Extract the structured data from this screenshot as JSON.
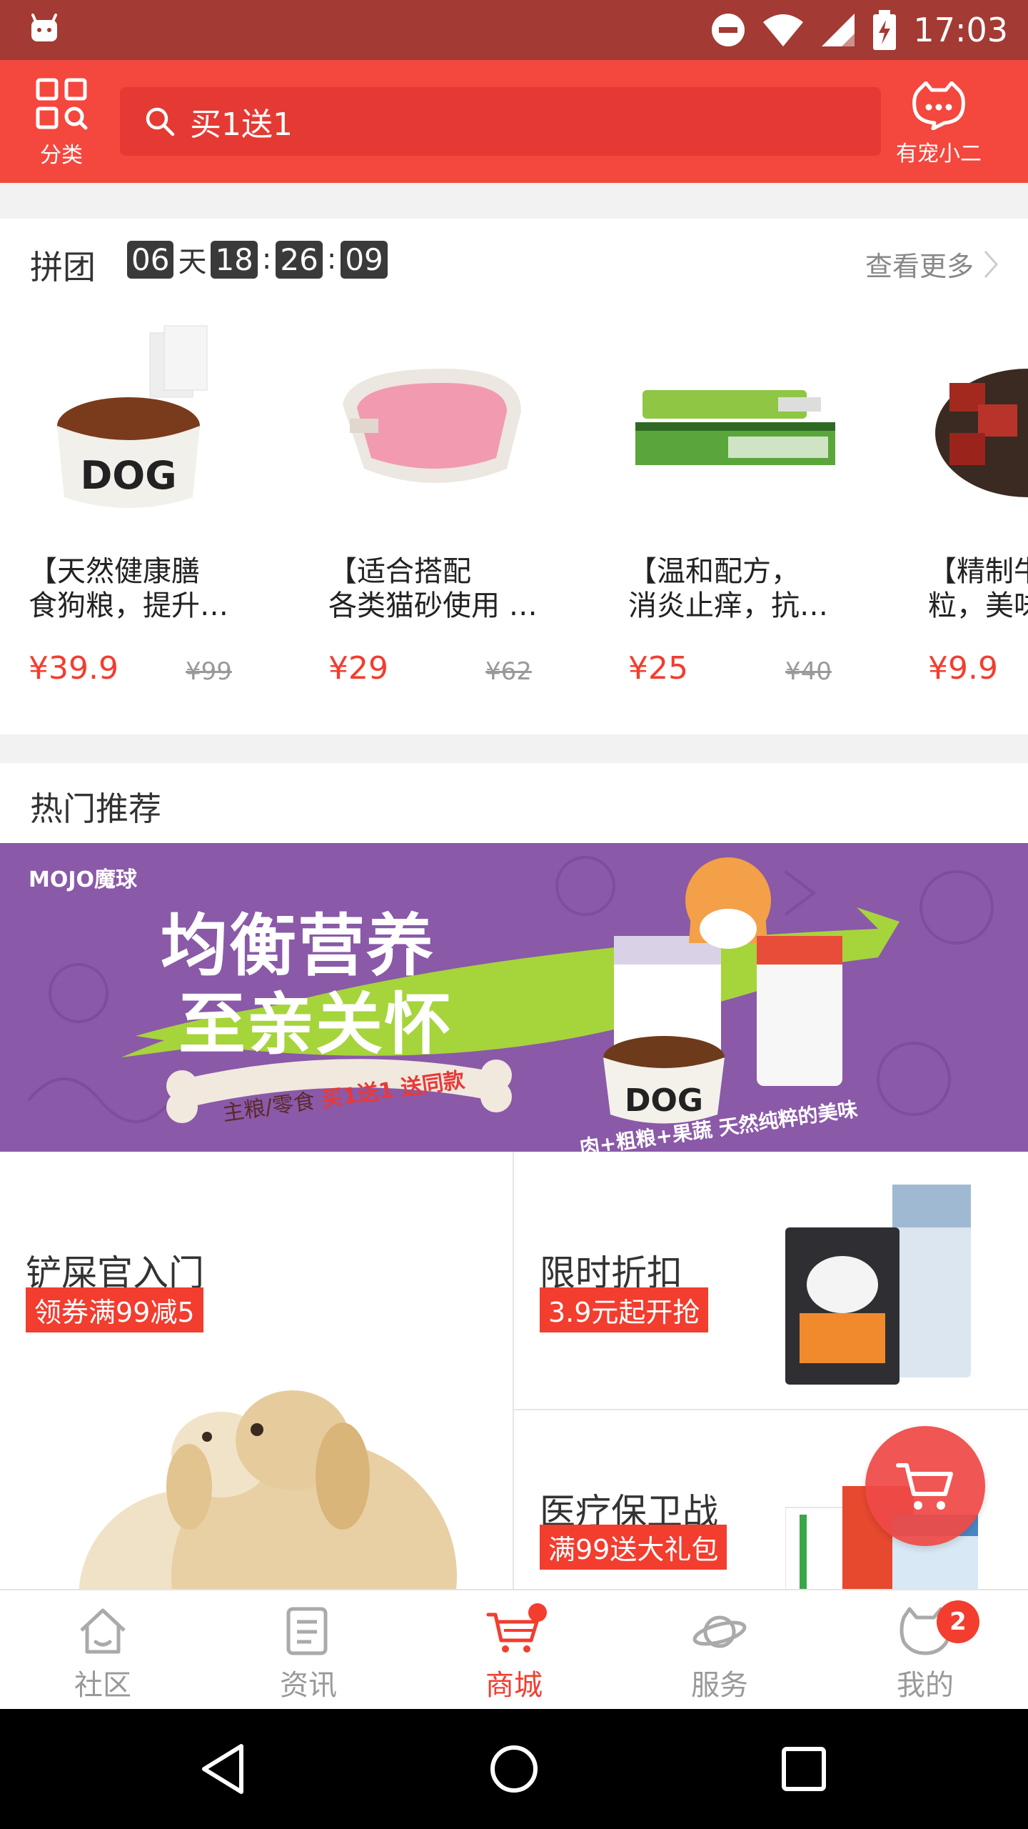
{
  "status_bar": {
    "time": "17:03"
  },
  "header": {
    "category_label": "分类",
    "search_placeholder": "买1送1",
    "helper_label": "有宠小二"
  },
  "group_buy": {
    "title": "拼团",
    "countdown": {
      "days": "06",
      "days_unit": "天",
      "hours": "18",
      "sep1": ":",
      "minutes": "26",
      "sep2": ":",
      "seconds": "09"
    },
    "more_label": "查看更多",
    "products": [
      {
        "name": "【天然健康膳\n食狗粮，提升…",
        "price": "¥39.9",
        "original_price": "¥99"
      },
      {
        "name": "【适合搭配\n各类猫砂使用 …",
        "price": "¥29",
        "original_price": "¥62"
      },
      {
        "name": "【温和配方，\n消炎止痒，抗…",
        "price": "¥25",
        "original_price": "¥40"
      },
      {
        "name": "【精制牛\n粒，美味",
        "price": "¥9.9",
        "original_price": ""
      }
    ]
  },
  "hot": {
    "title": "热门推荐",
    "banner": {
      "brand": "MOJO魔球",
      "headline1": "均衡营养",
      "headline2": "至亲关怀",
      "promo_prefix": "主粮/零食",
      "promo_text": "买1送1 送同款",
      "tagline": "肉+粗粮+果蔬  天然纯粹的美味"
    }
  },
  "grid": {
    "cell1": {
      "title": "铲屎官入门",
      "badge": "领券满99减5"
    },
    "cell2": {
      "title": "限时折扣",
      "badge": "3.9元起开抢"
    },
    "cell3": {
      "title": "医疗保卫战",
      "badge": "满99送大礼包"
    }
  },
  "tabbar": {
    "tabs": [
      {
        "label": "社区"
      },
      {
        "label": "资讯"
      },
      {
        "label": "商城"
      },
      {
        "label": "服务"
      },
      {
        "label": "我的"
      }
    ],
    "mine_badge": "2",
    "active_color": "#f23d2f"
  }
}
